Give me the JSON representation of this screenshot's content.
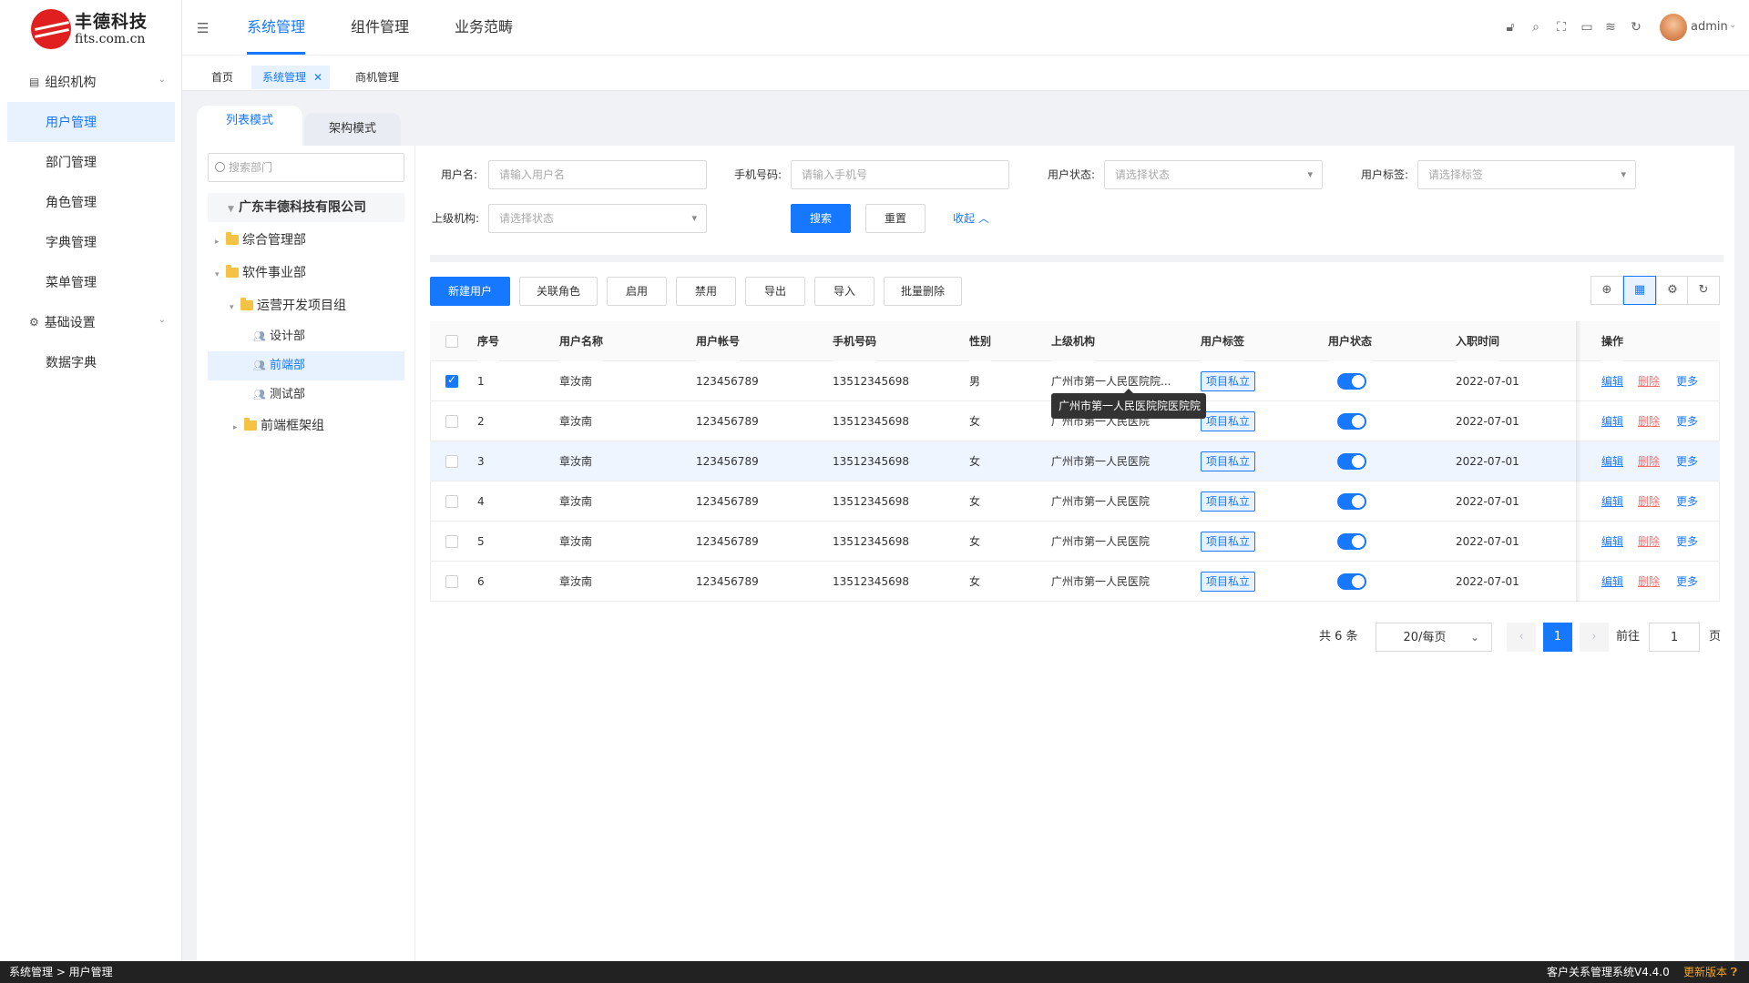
{
  "brand": {
    "name": "丰德科技",
    "domain": "fits.com.cn"
  },
  "sidebar": {
    "groups": [
      {
        "label": "组织机构",
        "items": [
          "用户管理",
          "部门管理",
          "角色管理",
          "字典管理",
          "菜单管理"
        ]
      },
      {
        "label": "基础设置",
        "items": [
          "数据字典"
        ]
      }
    ],
    "active_item": "用户管理"
  },
  "header": {
    "nav": [
      "系统管理",
      "组件管理",
      "业务范畴"
    ],
    "active_nav": "系统管理",
    "user": "admin"
  },
  "page_tabs": [
    "首页",
    "系统管理",
    "商机管理"
  ],
  "active_page_tab": "系统管理",
  "mode_tabs": [
    "列表模式",
    "架构模式"
  ],
  "tree": {
    "search_placeholder": "搜索部门",
    "root": "广东丰德科技有限公司",
    "nodes": [
      "综合管理部",
      "软件事业部",
      "运营开发项目组",
      "设计部",
      "前端部",
      "测试部",
      "前端框架组"
    ],
    "active_node": "前端部"
  },
  "filters": {
    "username_label": "用户名:",
    "username_placeholder": "请输入用户名",
    "phone_label": "手机号码:",
    "phone_placeholder": "请输入手机号",
    "status_label": "用户状态:",
    "status_placeholder": "请选择状态",
    "tag_label": "用户标签:",
    "tag_placeholder": "请选择标签",
    "org_label": "上级机构:",
    "org_placeholder": "请选择状态",
    "search_btn": "搜索",
    "reset_btn": "重置",
    "collapse_link": "收起"
  },
  "actions": [
    "新建用户",
    "关联角色",
    "启用",
    "禁用",
    "导出",
    "导入",
    "批量删除"
  ],
  "table": {
    "headers": [
      "序号",
      "用户名称",
      "用户帐号",
      "手机号码",
      "性别",
      "上级机构",
      "用户标签",
      "用户状态",
      "入职时间",
      "操作"
    ],
    "rows": [
      {
        "no": "1",
        "name": "章汝南",
        "account": "123456789",
        "phone": "13512345698",
        "gender": "男",
        "org": "广州市第一人民医院院...",
        "tag": "项目私立",
        "joined": "2022-07-01",
        "checked": true
      },
      {
        "no": "2",
        "name": "章汝南",
        "account": "123456789",
        "phone": "13512345698",
        "gender": "女",
        "org": "广州市第一人民医院",
        "tag": "项目私立",
        "joined": "2022-07-01",
        "checked": false
      },
      {
        "no": "3",
        "name": "章汝南",
        "account": "123456789",
        "phone": "13512345698",
        "gender": "女",
        "org": "广州市第一人民医院",
        "tag": "项目私立",
        "joined": "2022-07-01",
        "checked": false
      },
      {
        "no": "4",
        "name": "章汝南",
        "account": "123456789",
        "phone": "13512345698",
        "gender": "女",
        "org": "广州市第一人民医院",
        "tag": "项目私立",
        "joined": "2022-07-01",
        "checked": false
      },
      {
        "no": "5",
        "name": "章汝南",
        "account": "123456789",
        "phone": "13512345698",
        "gender": "女",
        "org": "广州市第一人民医院",
        "tag": "项目私立",
        "joined": "2022-07-01",
        "checked": false
      },
      {
        "no": "6",
        "name": "章汝南",
        "account": "123456789",
        "phone": "13512345698",
        "gender": "女",
        "org": "广州市第一人民医院",
        "tag": "项目私立",
        "joined": "2022-07-01",
        "checked": false
      }
    ],
    "ops": {
      "edit": "编辑",
      "delete": "删除",
      "more": "更多"
    },
    "tooltip": "广州市第一人民医院院医院院"
  },
  "pagination": {
    "total": "共 6 条",
    "page_size": "20/每页",
    "current": "1",
    "goto_label": "前往",
    "goto_value": "1",
    "page_unit": "页"
  },
  "footer": {
    "breadcrumb": "系统管理 > 用户管理",
    "version": "客户关系管理系统V4.4.0",
    "update": "更新版本"
  },
  "colors": {
    "accent": "#1677ff",
    "danger": "#f56c6c",
    "footer_bg": "#222222",
    "update": "#f5a623"
  }
}
